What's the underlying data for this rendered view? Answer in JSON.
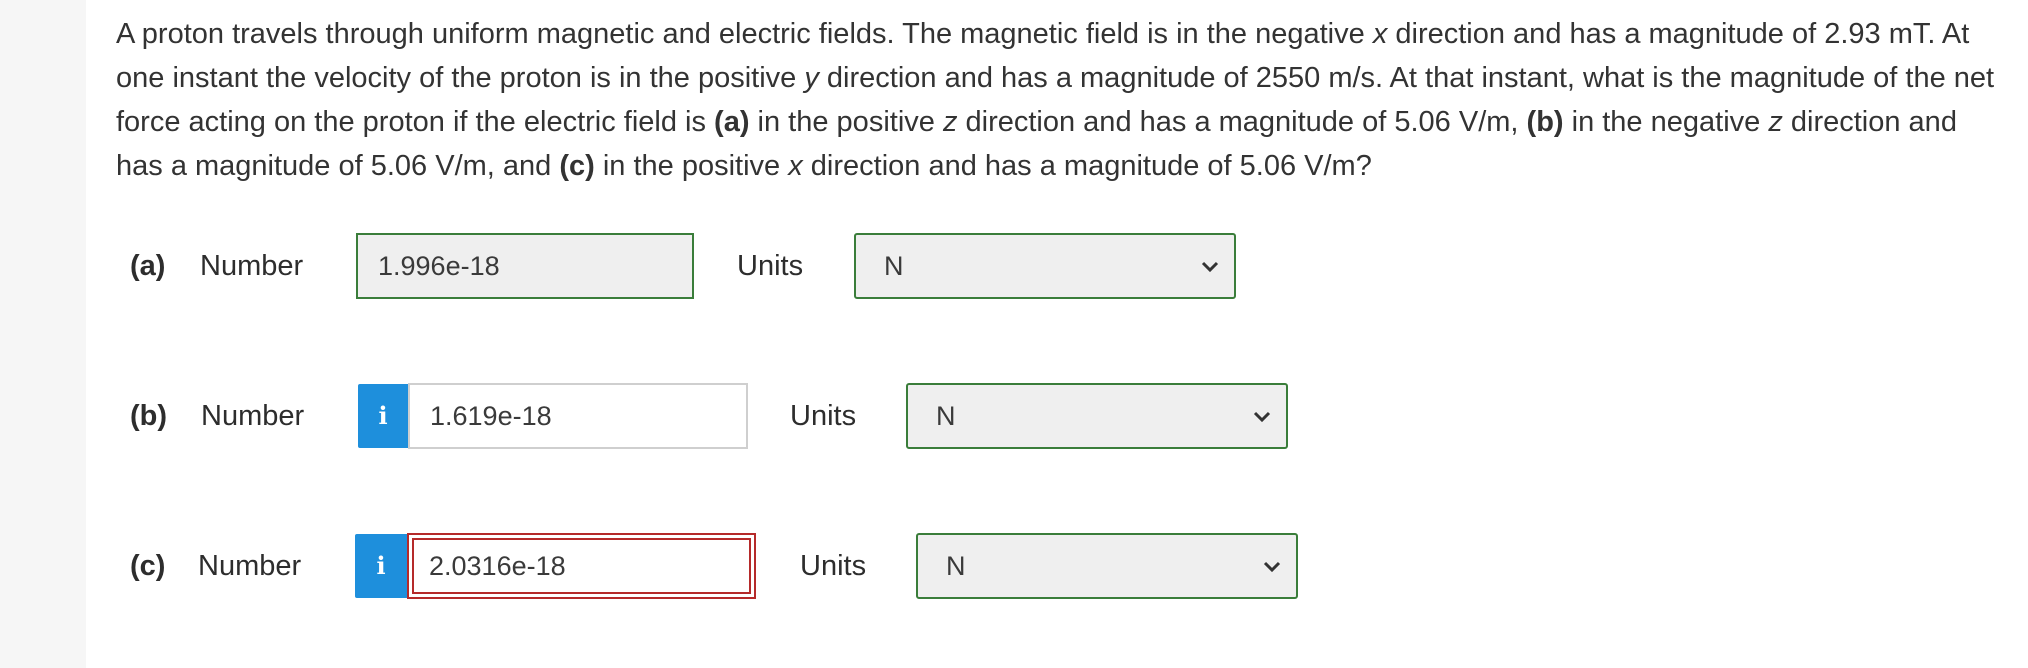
{
  "question": {
    "s1": "A proton travels through uniform magnetic and electric fields. The magnetic field is in the negative ",
    "s1_var": "x",
    "s2": " direction and has a magnitude of 2.93 mT. At one instant the velocity of the proton is in the positive ",
    "s2_var": "y",
    "s3": " direction and has a magnitude of 2550 m/s. At that instant, what is the magnitude of the net force acting on the proton if the electric field is ",
    "a_tag": "(a)",
    "s4": " in the positive ",
    "s4_var": "z",
    "s5": " direction and has a magnitude of 5.06 V/m, ",
    "b_tag": "(b)",
    "s6": " in the negative ",
    "s6_var": "z",
    "s7": " direction and has a magnitude of 5.06 V/m, and ",
    "c_tag": "(c)",
    "s8": " in the positive ",
    "s8_var": "x",
    "s9": " direction and has a magnitude of 5.06 V/m?"
  },
  "parts": [
    {
      "label": "(a)",
      "number_label": "Number",
      "value": "1.996e-18",
      "state": "correct",
      "units_label": "Units",
      "units_value": "N"
    },
    {
      "label": "(b)",
      "number_label": "Number",
      "info_icon": "i",
      "value": "1.619e-18",
      "state": "plain",
      "units_label": "Units",
      "units_value": "N"
    },
    {
      "label": "(c)",
      "number_label": "Number",
      "info_icon": "i",
      "value": "2.0316e-18",
      "state": "wrong",
      "units_label": "Units",
      "units_value": "N"
    }
  ],
  "colors": {
    "correct_border": "#3a7d3a",
    "wrong_border": "#b52a2a",
    "info_blue": "#1e8fdc"
  },
  "icons": {
    "info": "info-icon",
    "dropdown": "chevron-down-icon"
  }
}
